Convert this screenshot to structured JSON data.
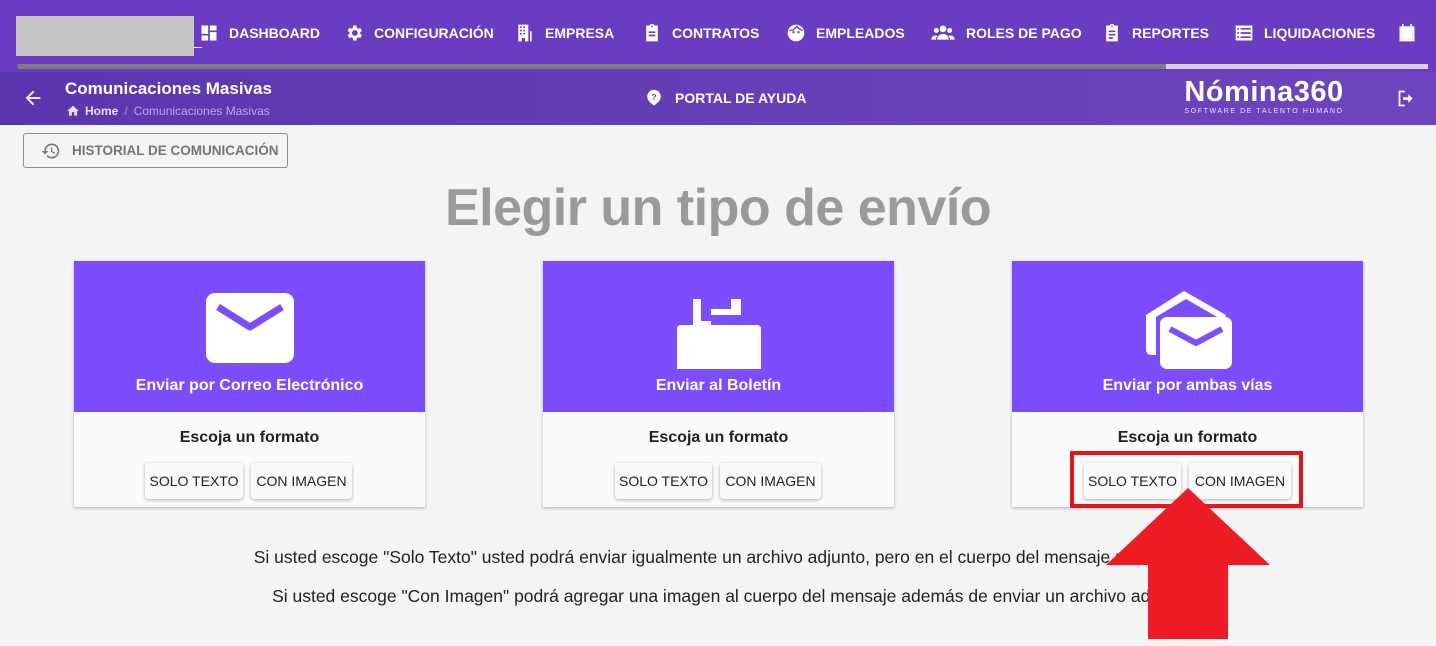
{
  "nav": {
    "items": [
      {
        "label": "DASHBOARD",
        "icon": "dashboard-icon"
      },
      {
        "label": "CONFIGURACIÓN",
        "icon": "gear-icon"
      },
      {
        "label": "EMPRESA",
        "icon": "building-icon"
      },
      {
        "label": "CONTRATOS",
        "icon": "clipboard-icon"
      },
      {
        "label": "EMPLEADOS",
        "icon": "face-icon"
      },
      {
        "label": "ROLES DE PAGO",
        "icon": "group-icon"
      },
      {
        "label": "REPORTES",
        "icon": "report-clipboard-icon"
      },
      {
        "label": "LIQUIDACIONES",
        "icon": "list-icon"
      },
      {
        "label": "",
        "icon": "calendar-icon"
      }
    ]
  },
  "header": {
    "title": "Comunicaciones Masivas",
    "breadcrumb": {
      "home": "Home",
      "separator": "/",
      "current": "Comunicaciones Masivas"
    },
    "help_label": "PORTAL DE AYUDA",
    "brand_name": "Nómina360",
    "brand_tagline": "SOFTWARE DE TALENTO HUMANO"
  },
  "history_button": {
    "label": "HISTORIAL DE COMUNICACIÓN",
    "icon": "history-icon"
  },
  "heading": "Elegir un tipo de envío",
  "cards": [
    {
      "title": "Enviar por Correo Electrónico",
      "subtitle": "Escoja un formato",
      "btn_text": "SOLO TEXTO",
      "btn_image": "CON IMAGEN",
      "icon": "email-icon"
    },
    {
      "title": "Enviar al Boletín",
      "subtitle": "Escoja un formato",
      "btn_text": "SOLO TEXTO",
      "btn_image": "CON IMAGEN",
      "icon": "mailbox-icon"
    },
    {
      "title": "Enviar por ambas vías",
      "subtitle": "Escoja un formato",
      "btn_text": "SOLO TEXTO",
      "btn_image": "CON IMAGEN",
      "icon": "drafts-email-icon"
    }
  ],
  "info": {
    "line1": "Si usted escoge \"Solo Texto\" usted podrá enviar igualmente un archivo adjunto, pero en el cuerpo del mensaje no se en",
    "line2": "Si usted escoge \"Con Imagen\" podrá agregar una imagen al cuerpo del mensaje además de enviar un archivo adju"
  },
  "colors": {
    "nav_bg": "#6a3cc2",
    "card_accent": "#7c4dff",
    "annotation_red": "#e4141c",
    "heading_grey": "#9a9a9a"
  }
}
